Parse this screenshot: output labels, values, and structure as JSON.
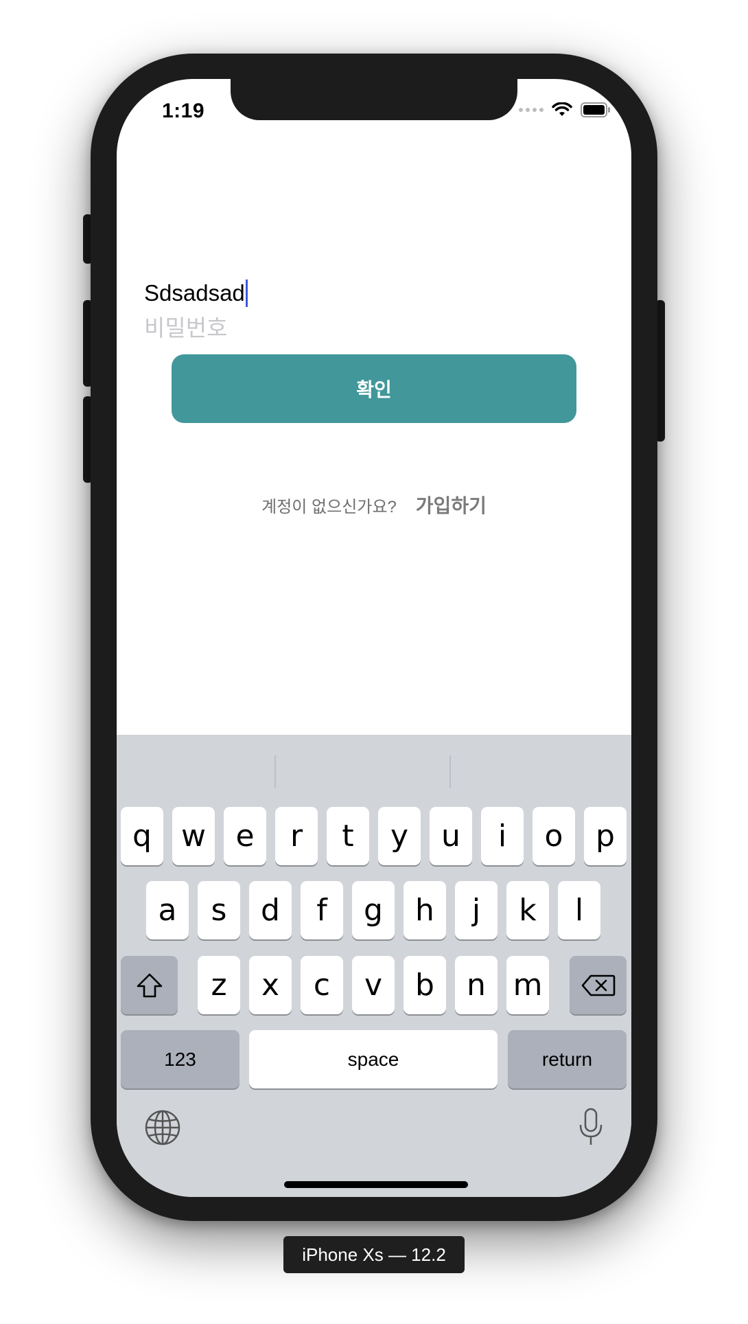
{
  "status_bar": {
    "time": "1:19"
  },
  "login": {
    "id_value": "Sdsadsad",
    "password_placeholder": "비밀번호",
    "confirm_label": "확인",
    "signup_question": "계정이 없으신가요?",
    "signup_link": "가입하기"
  },
  "keyboard": {
    "row1": [
      "q",
      "w",
      "e",
      "r",
      "t",
      "y",
      "u",
      "i",
      "o",
      "p"
    ],
    "row2": [
      "a",
      "s",
      "d",
      "f",
      "g",
      "h",
      "j",
      "k",
      "l"
    ],
    "row3": [
      "z",
      "x",
      "c",
      "v",
      "b",
      "n",
      "m"
    ],
    "numbers_label": "123",
    "space_label": "space",
    "return_label": "return"
  },
  "device_label": "iPhone Xs — 12.2",
  "colors": {
    "accent": "#41979a",
    "keyboard_bg": "#d1d4d9"
  }
}
